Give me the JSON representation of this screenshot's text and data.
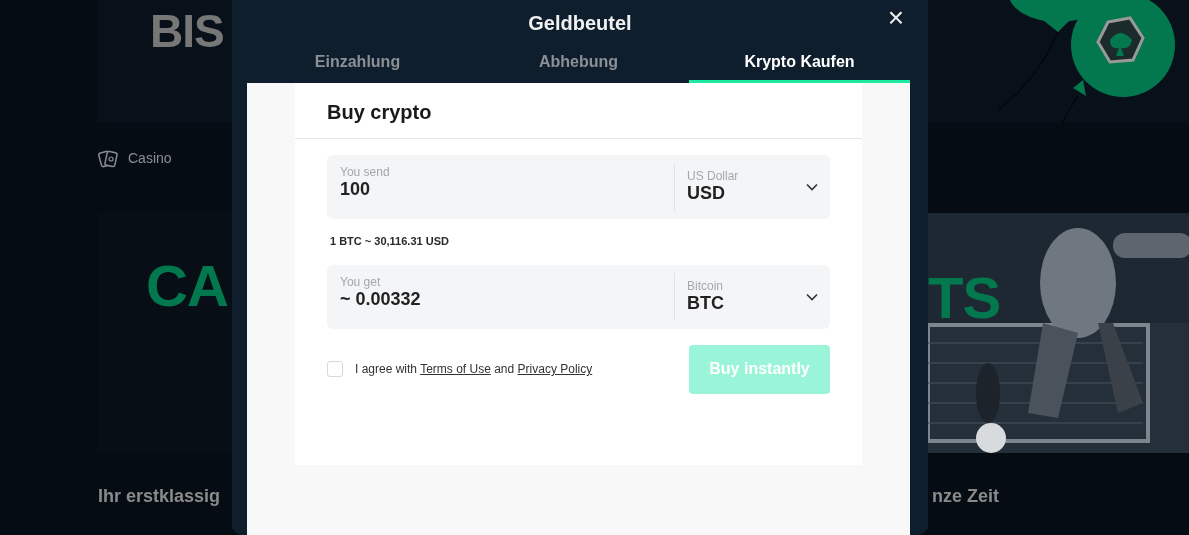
{
  "background": {
    "hero_title": "BIS",
    "nav_items": [
      {
        "label": "Casino"
      }
    ],
    "banners": [
      {
        "title": "CA"
      },
      {
        "title": "TS",
        "kind": "picture"
      }
    ],
    "headings": [
      "Ihr erstklassig",
      "nze Zeit"
    ]
  },
  "modal": {
    "title": "Geldbeutel",
    "close": "×",
    "tabs": [
      {
        "label": "Einzahlung",
        "selected": false
      },
      {
        "label": "Abhebung",
        "selected": false
      },
      {
        "label": "Krypto Kaufen",
        "selected": true
      }
    ],
    "card": {
      "title": "Buy crypto",
      "fields": [
        {
          "label": "You send",
          "value": "100",
          "currency_label": "US Dollar",
          "currency": "USD"
        },
        {
          "label": "You get",
          "value": "~ 0.00332",
          "currency_label": "Bitcoin",
          "currency": "BTC"
        }
      ],
      "rate": "1 BTC ~ 30,116.31 USD",
      "agreement": {
        "checked": false,
        "text_before": "I agree with",
        "link_1": "Terms of Use",
        "text_middle": "and",
        "link_2": "Privacy Policy"
      },
      "submit": {
        "label": "Buy instantly",
        "disabled": true
      }
    }
  }
}
